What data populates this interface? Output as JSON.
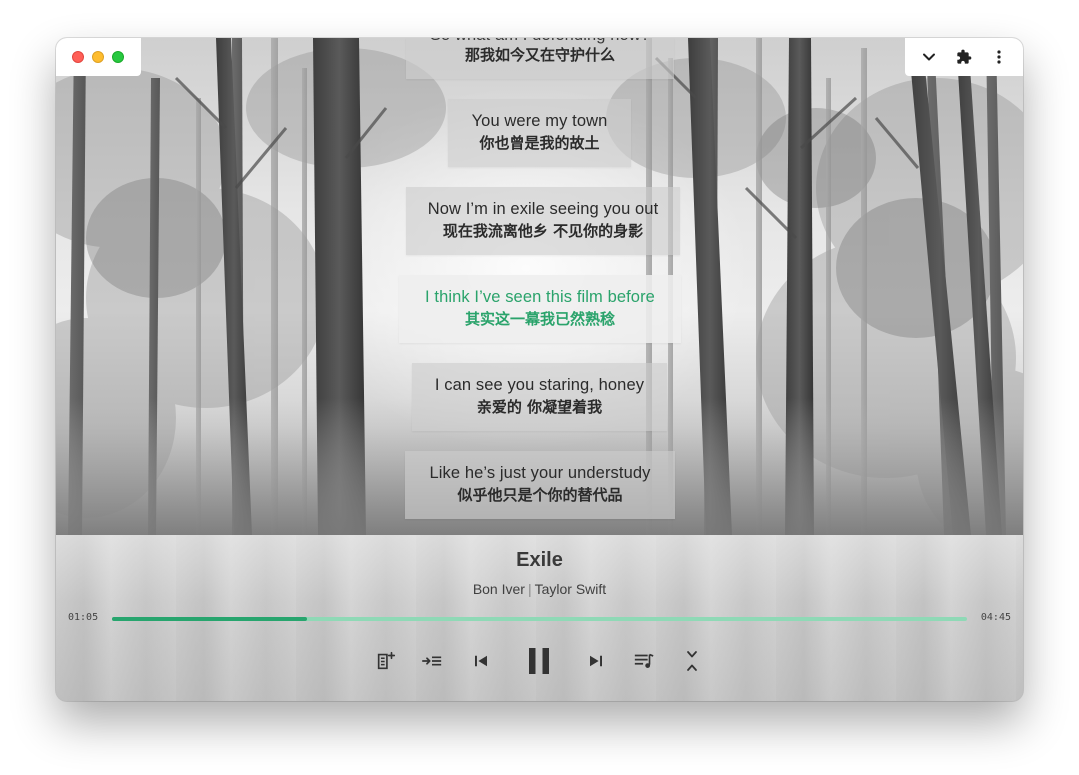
{
  "lyrics": [
    {
      "en": "So what am I defending now?",
      "zh": "那我如今又在守护什么"
    },
    {
      "en": "You were my town",
      "zh": "你也曾是我的故土"
    },
    {
      "en": "Now I’m in exile seeing you out",
      "zh": "现在我流离他乡 不见你的身影"
    },
    {
      "en": "I think I’ve seen this film before",
      "zh": "其实这一幕我已然熟稔"
    },
    {
      "en": "I can see you staring, honey",
      "zh": "亲爱的 你凝望着我"
    },
    {
      "en": "Like he’s just your understudy",
      "zh": "似乎他只是个你的替代品"
    }
  ],
  "active_lyric_index": 3,
  "song": {
    "title": "Exile",
    "artist_1": "Bon Iver",
    "artist_separator": "|",
    "artist_2": "Taylor Swift"
  },
  "progress": {
    "current": "01:05",
    "duration": "04:45",
    "fraction": 0.228
  },
  "controls": {
    "add_to_playlist_icon": "add-to-playlist-icon",
    "play_next_icon": "play-next-icon",
    "previous_icon": "skip-previous-icon",
    "pause_icon": "pause-icon",
    "next_icon": "skip-next-icon",
    "queue_icon": "queue-music-icon",
    "collapse_icon": "collapse-icon"
  },
  "titlebar_tools": [
    "chevron-down-icon",
    "puzzle-icon",
    "more-vertical-icon"
  ],
  "colors": {
    "accent": "#27a56e",
    "accent_track": "#8fd9b6",
    "active_lyric": "#2aa36b"
  }
}
